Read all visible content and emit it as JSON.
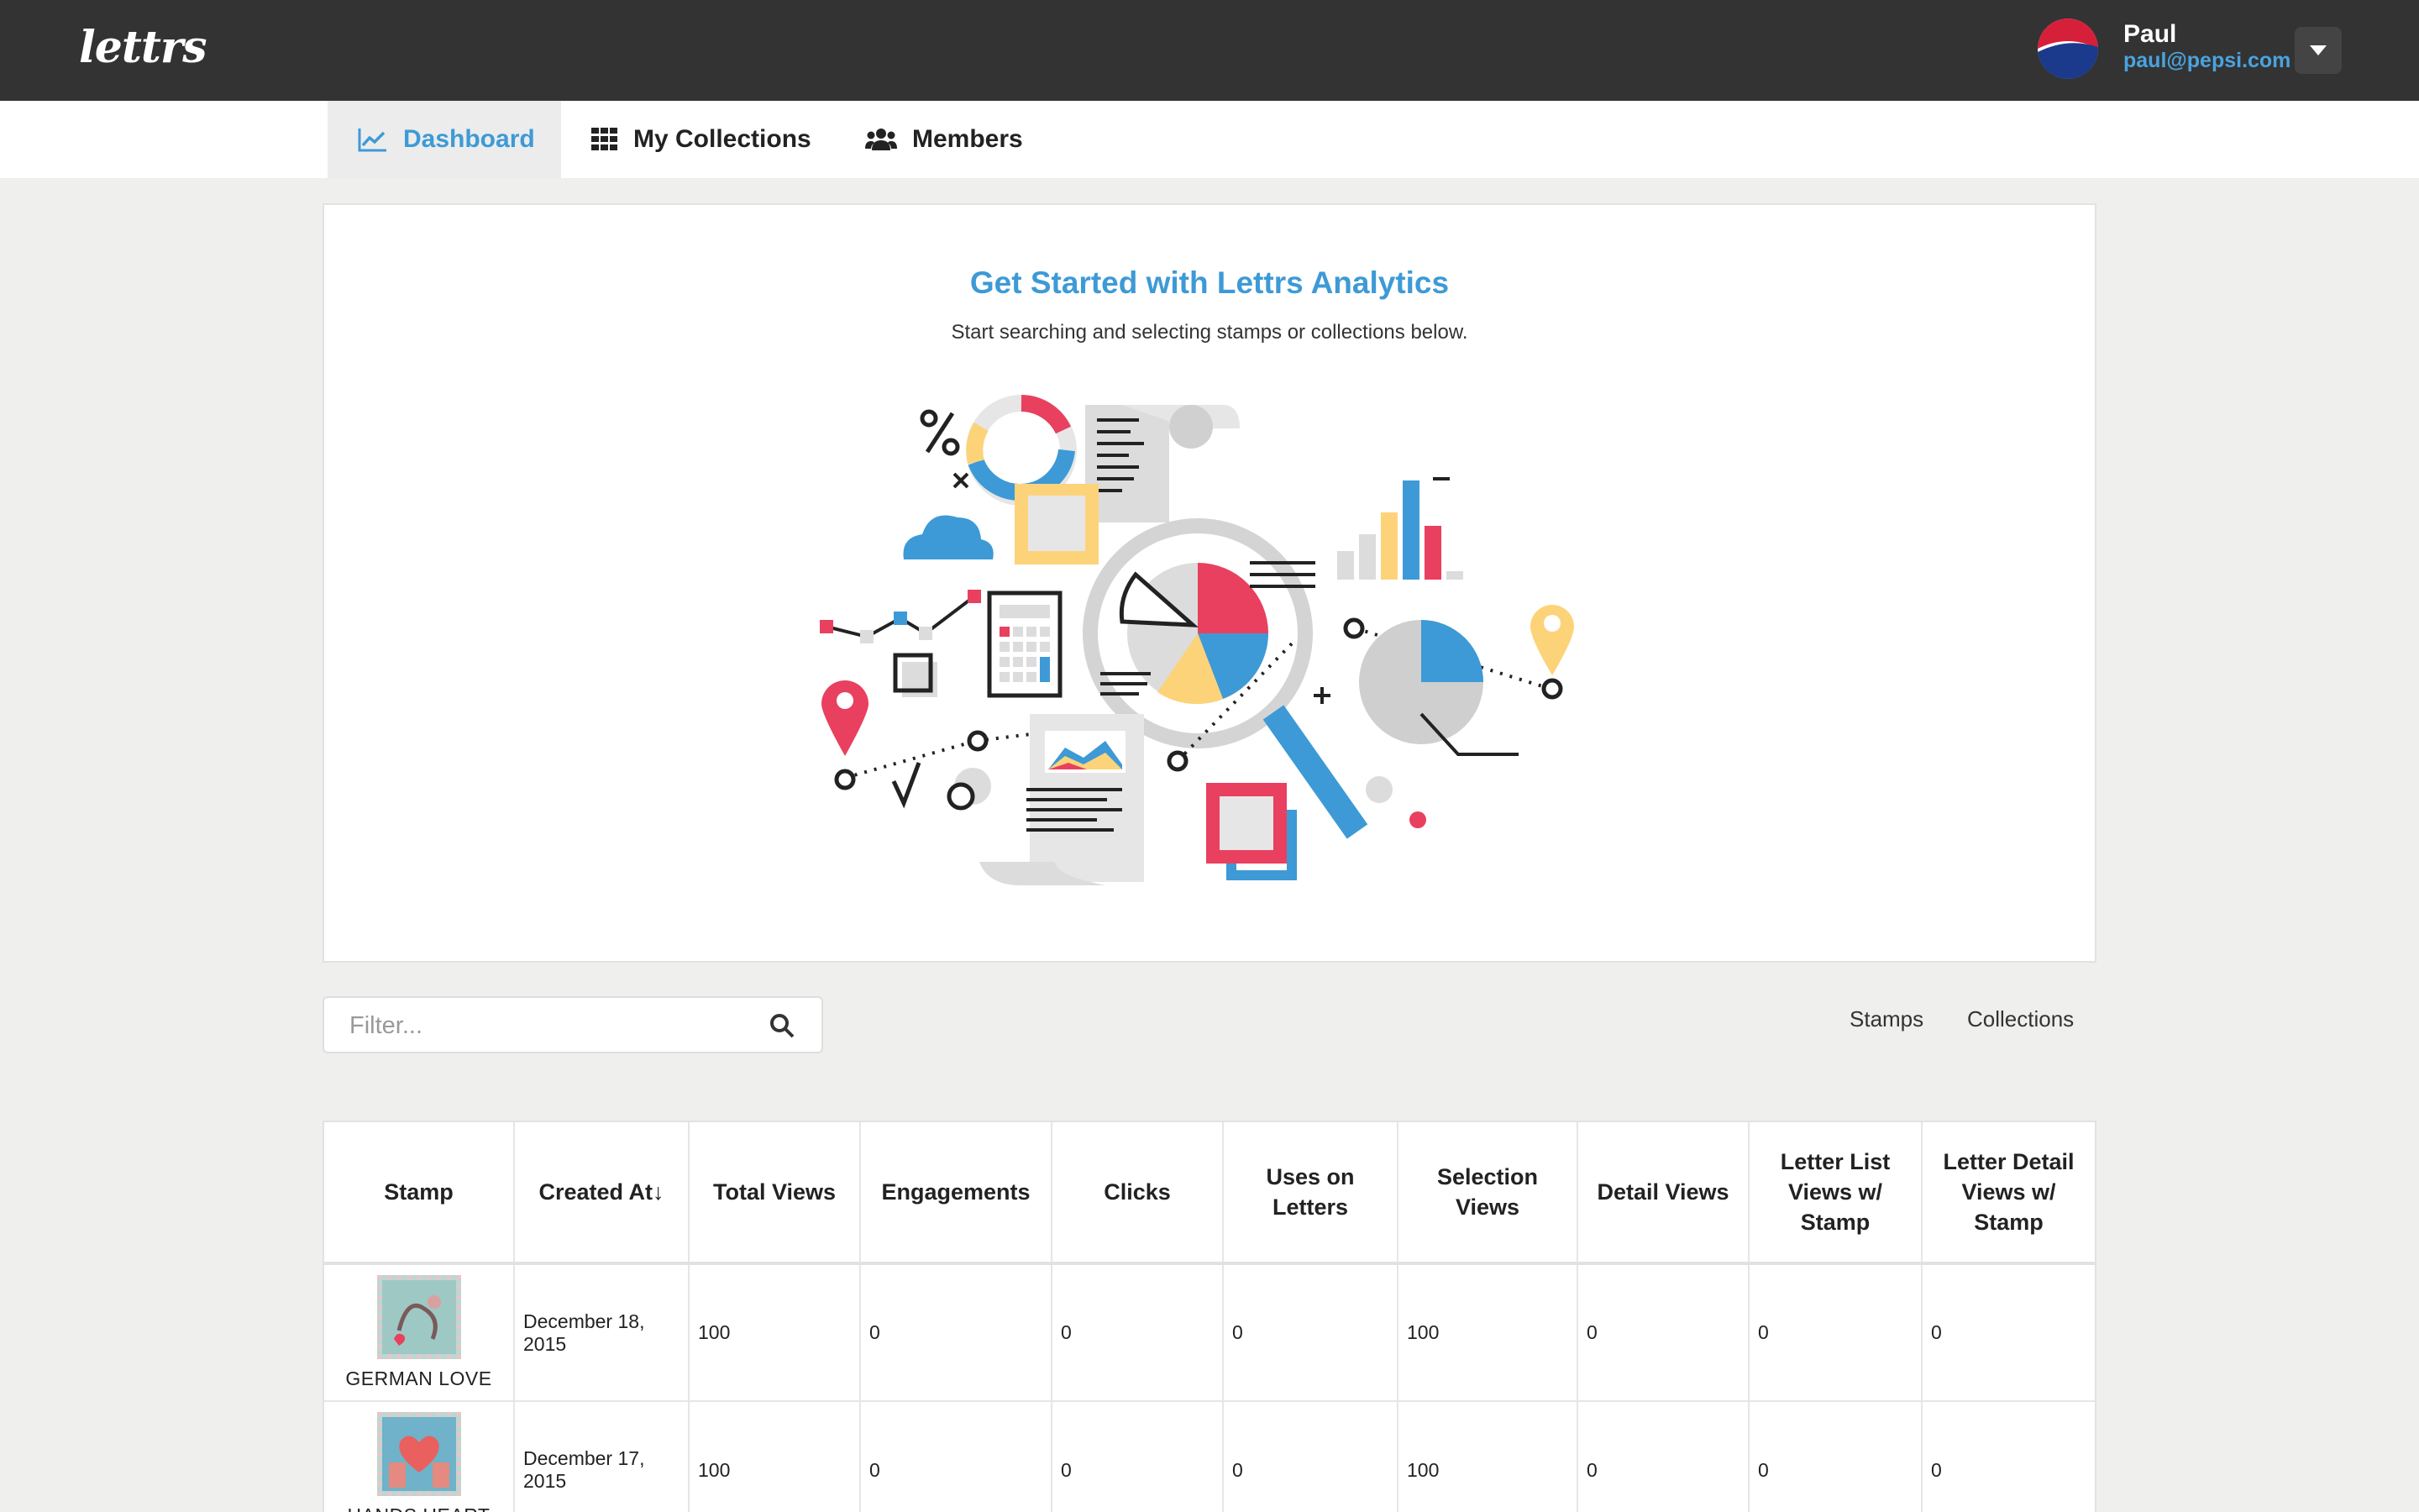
{
  "header": {
    "logo": "lettrs",
    "user_name": "Paul",
    "user_email": "paul@pepsi.com"
  },
  "nav": {
    "tabs": [
      {
        "label": "Dashboard",
        "icon": "line-chart-icon",
        "active": true
      },
      {
        "label": "My Collections",
        "icon": "grid-icon",
        "active": false
      },
      {
        "label": "Members",
        "icon": "users-icon",
        "active": false
      }
    ]
  },
  "hero": {
    "title": "Get Started with Lettrs Analytics",
    "subtitle": "Start searching and selecting stamps or collections below."
  },
  "filter": {
    "placeholder": "Filter...",
    "value": ""
  },
  "view_toggle": {
    "stamps_label": "Stamps",
    "collections_label": "Collections"
  },
  "table": {
    "columns": [
      "Stamp",
      "Created At↓",
      "Total Views",
      "Engagements",
      "Clicks",
      "Uses on Letters",
      "Selection Views",
      "Detail Views",
      "Letter List Views w/ Stamp",
      "Letter Detail Views w/ Stamp"
    ],
    "rows": [
      {
        "stamp": "GERMAN LOVE",
        "created_at": "December 18, 2015",
        "total_views": "100",
        "engagements": "0",
        "clicks": "0",
        "uses": "0",
        "selection_views": "100",
        "detail_views": "0",
        "letter_list_views": "0",
        "letter_detail_views": "0"
      },
      {
        "stamp": "HANDS HEART",
        "created_at": "December 17, 2015",
        "total_views": "100",
        "engagements": "0",
        "clicks": "0",
        "uses": "0",
        "selection_views": "100",
        "detail_views": "0",
        "letter_list_views": "0",
        "letter_detail_views": "0"
      }
    ]
  },
  "colors": {
    "topbar": "#333333",
    "accent_blue": "#3d9ad6",
    "accent_red": "#e9405f",
    "accent_yellow": "#fdd37a",
    "grey": "#cfcfcf"
  }
}
